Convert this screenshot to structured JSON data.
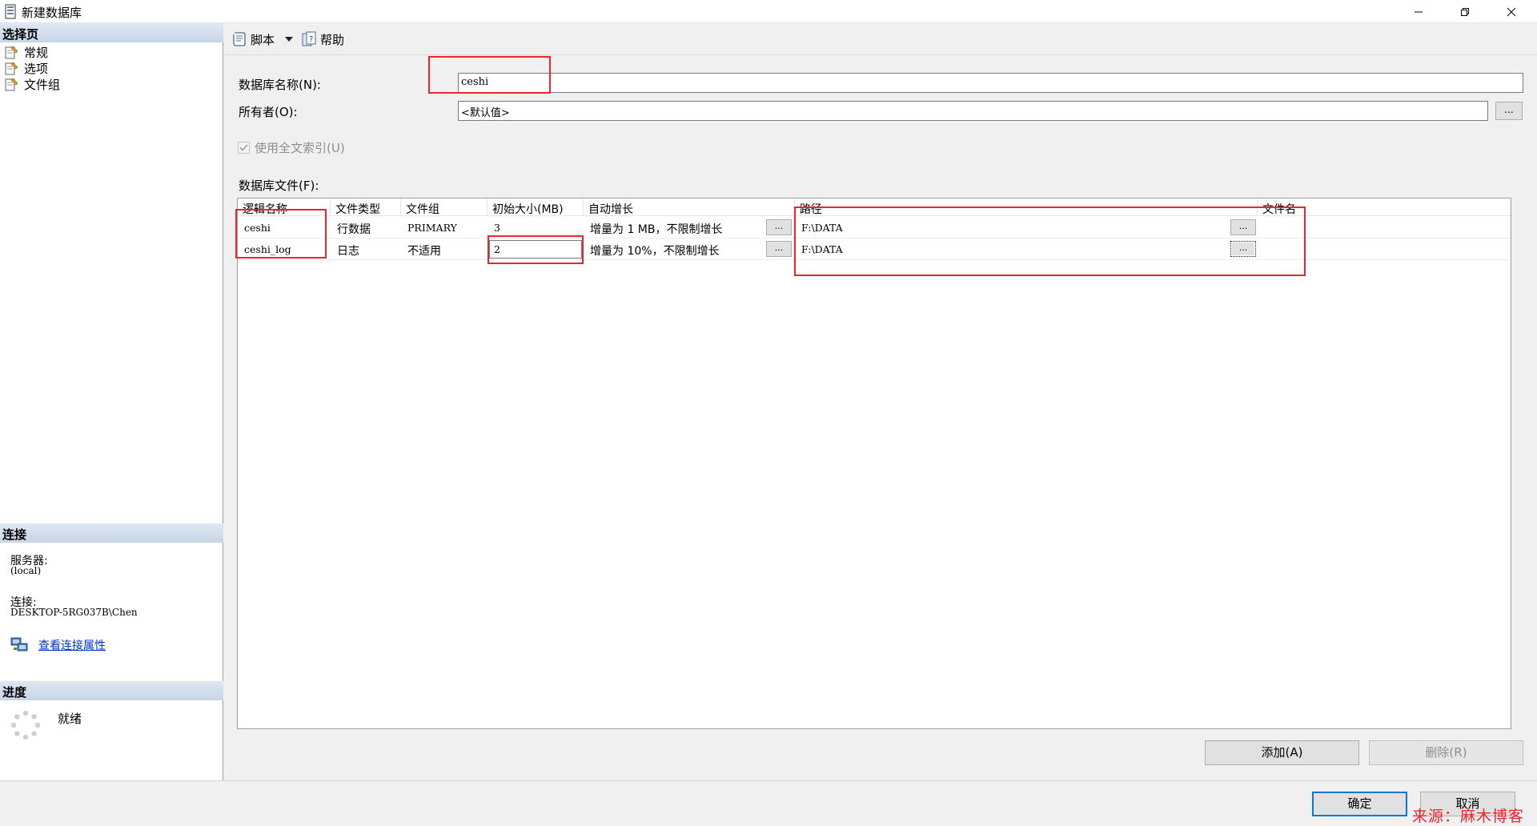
{
  "window": {
    "title": "新建数据库",
    "controls": [
      "minimize-icon",
      "restore-icon",
      "close-icon"
    ]
  },
  "left_pane": {
    "pages_header": "选择页",
    "pages": [
      {
        "label": "常规",
        "icon": "page-wrench-icon"
      },
      {
        "label": "选项",
        "icon": "page-wrench-icon"
      },
      {
        "label": "文件组",
        "icon": "page-wrench-icon"
      }
    ],
    "connection_header": "连接",
    "server_label": "服务器:",
    "server_value": "(local)",
    "connection_label": "连接:",
    "connection_value": "DESKTOP-5RG037B\\Chen",
    "view_connection_link": "查看连接属性",
    "progress_header": "进度",
    "progress_status": "就绪"
  },
  "toolbar": {
    "script_label": "脚本",
    "help_label": "帮助"
  },
  "form": {
    "db_name_label": "数据库名称(N):",
    "db_name_value": "ceshi",
    "owner_label": "所有者(O):",
    "owner_value": "<默认值>",
    "owner_browse": "...",
    "fulltext_label": "使用全文索引(U)",
    "fulltext_checked": true,
    "files_label": "数据库文件(F):"
  },
  "files_grid": {
    "columns": [
      "逻辑名称",
      "文件类型",
      "文件组",
      "初始大小(MB)",
      "自动增长",
      "路径",
      "文件名"
    ],
    "rows": [
      {
        "logical_name": "ceshi",
        "file_type": "行数据",
        "filegroup": "PRIMARY",
        "initial_size": "3",
        "autogrowth": "增量为 1 MB，不限制增长",
        "autogrowth_btn": "...",
        "path": "F:\\DATA",
        "path_btn": "...",
        "file_name": ""
      },
      {
        "logical_name": "ceshi_log",
        "file_type": "日志",
        "filegroup": "不适用",
        "initial_size": "2",
        "autogrowth": "增量为 10%，不限制增长",
        "autogrowth_btn": "...",
        "path": "F:\\DATA",
        "path_btn": "...",
        "file_name": ""
      }
    ]
  },
  "grid_buttons": {
    "add_label": "添加(A)",
    "remove_label": "删除(R)"
  },
  "dialog_buttons": {
    "ok_label": "确定",
    "cancel_label": "取消"
  },
  "watermark": "来源：麻木博客",
  "colors": {
    "annotation_red": "#e8262f",
    "section_header": "#c6d5e6",
    "link_blue": "#0033cc",
    "focus_blue": "#0078d7"
  }
}
